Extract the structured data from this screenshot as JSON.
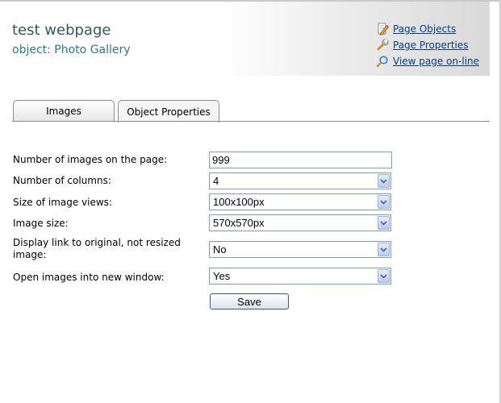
{
  "header": {
    "title": "test webpage",
    "object_label": "object: Photo Gallery",
    "links": [
      {
        "label": "Page Objects",
        "icon": "pencil-icon"
      },
      {
        "label": "Page Properties",
        "icon": "wrench-icon"
      },
      {
        "label": "View page on-line",
        "icon": "magnifier-icon"
      }
    ]
  },
  "tabs": [
    {
      "label": "Images",
      "active": false
    },
    {
      "label": "Object Properties",
      "active": true
    }
  ],
  "form": {
    "fields": [
      {
        "label": "Number of images on the page:",
        "type": "text",
        "value": "999"
      },
      {
        "label": "Number of columns:",
        "type": "select",
        "value": "4"
      },
      {
        "label": "Size of image views:",
        "type": "select",
        "value": "100x100px"
      },
      {
        "label": "Image size:",
        "type": "select",
        "value": "570x570px"
      },
      {
        "label": "Display link to original, not resized image:",
        "type": "select",
        "value": "No"
      },
      {
        "label": "Open images into new window:",
        "type": "select",
        "value": "Yes"
      }
    ],
    "save_label": "Save"
  },
  "colors": {
    "title": "#2e5a63",
    "link": "#0b3f7a",
    "input_border": "#7f9db9"
  }
}
